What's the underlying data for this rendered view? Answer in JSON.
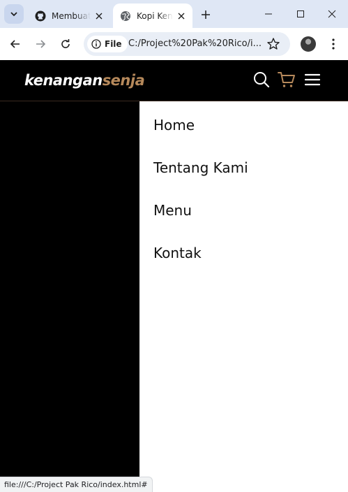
{
  "browser": {
    "tabs": [
      {
        "title": "Membuat Website dengan HTML",
        "active": false
      },
      {
        "title": "Kopi Kenangan Senja",
        "active": true
      }
    ],
    "omnibox": {
      "chip_label": "File",
      "url": "C:/Project%20Pak%20Rico/i..."
    },
    "status_url": "file:///C:/Project Pak Rico/index.html#"
  },
  "site": {
    "logo_part1": "kenangan",
    "logo_part2": "senja",
    "nav": [
      {
        "label": "Home"
      },
      {
        "label": "Tentang Kami"
      },
      {
        "label": "Menu"
      },
      {
        "label": "Kontak"
      }
    ]
  },
  "colors": {
    "accent": "#b6895b",
    "header_bg": "#000000",
    "drawer_bg": "#ffffff",
    "tabstrip_bg": "#dfe7f5"
  },
  "icons": [
    "tab-search-icon",
    "github-icon",
    "globe-icon",
    "close-icon",
    "plus-icon",
    "minimize-icon",
    "maximize-icon",
    "back-icon",
    "forward-icon",
    "reload-icon",
    "info-icon",
    "star-icon",
    "kebab-icon",
    "search-icon",
    "cart-icon",
    "hamburger-icon"
  ]
}
